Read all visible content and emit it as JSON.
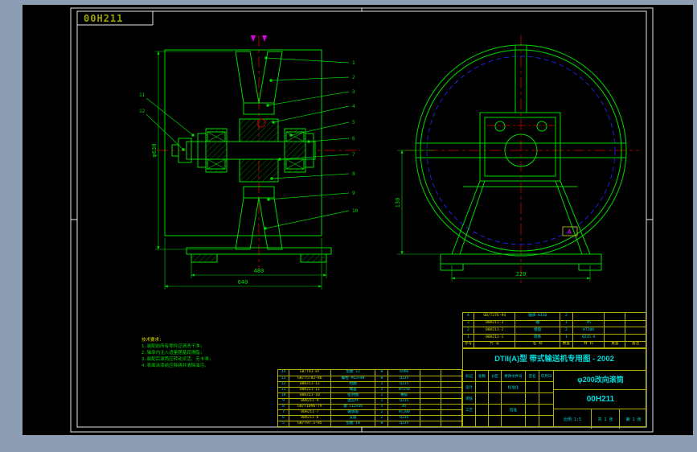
{
  "window": {
    "drawing_label": "00H211"
  },
  "colors": {
    "line_green": "#00d800",
    "center_red": "#d40000",
    "dash_blue": "#2222ee",
    "grid_yellow": "#b0b000",
    "text_cyan": "#00dcdc",
    "magenta": "#e000e0",
    "frame_white": "#e8e8e8",
    "label_olive": "#9aa000",
    "canvas_black": "#000000",
    "window_gray": "#8d9db4"
  },
  "notes": {
    "lines": [
      "技术要求:",
      "1.装配前所有零件应清洗干净;",
      "2.轴承内注入适量锂基润滑脂;",
      "3.装配后滚筒应转动灵活、无卡滞;",
      "4.表面涂漆前应除锈并清除油污。"
    ]
  },
  "left_view": {
    "callouts": [
      "1",
      "2",
      "3",
      "4",
      "5",
      "6",
      "7",
      "8",
      "9",
      "10",
      "11",
      "12"
    ],
    "dim_width_inner": "480",
    "dim_width_outer": "640",
    "dim_left": "φ630"
  },
  "right_view": {
    "dim_bottom": "220",
    "dim_left": "130",
    "detail_label": "A"
  },
  "title_block": {
    "std_line": "DTII(A)型 带式输送机专用图 - 2002",
    "part_name": "φ200改向滚筒",
    "drawing_no": "00H211",
    "scale_text": "比例 1:5",
    "sheet_total": "共 1 张",
    "sheet_no": "第 1 张",
    "sig_rows": [
      [
        "标记",
        "处数",
        "分区",
        "更改文件号",
        "签名",
        "年月日"
      ],
      [
        "设计",
        "",
        "",
        "标准化",
        "",
        ""
      ],
      [
        "审核",
        "",
        "",
        "",
        "",
        ""
      ],
      [
        "工艺",
        "",
        "",
        "批准",
        "",
        ""
      ],
      [
        "",
        "",
        "",
        "",
        "",
        ""
      ]
    ]
  },
  "bom_upper": {
    "rows": [
      [
        "4",
        "GB/T276-94",
        "轴承 6310",
        "2",
        "",
        "",
        ""
      ],
      [
        "3",
        "00H211-3",
        "轴",
        "1",
        "45",
        "",
        ""
      ],
      [
        "2",
        "00H211-2",
        "接盘",
        "2",
        "HT200",
        "",
        ""
      ],
      [
        "1",
        "00H211-1",
        "筒体",
        "1",
        "Q235-A",
        "",
        ""
      ]
    ],
    "headers": [
      "序号",
      "代 号",
      "名 称",
      "数量",
      "材 料",
      "重量",
      "备注"
    ]
  },
  "bom_left": {
    "rows": [
      [
        "14",
        "GB/T93-87",
        "垫圈 12",
        "8",
        "65Mn",
        "",
        ""
      ],
      [
        "13",
        "GB/T5782-86",
        "螺栓 M12×40",
        "8",
        "Q235",
        "",
        ""
      ],
      [
        "12",
        "00H211-12",
        "挡圈",
        "2",
        "Q235",
        "",
        ""
      ],
      [
        "11",
        "00H211-11",
        "端盖",
        "2",
        "HT150",
        "",
        ""
      ],
      [
        "10",
        "00H211-10",
        "密封圈",
        "2",
        "橡胶",
        "",
        ""
      ],
      [
        "9",
        "00H211-9",
        "迷宫环",
        "2",
        "Q235",
        "",
        ""
      ],
      [
        "8",
        "GB/T1096-79",
        "键 C12×56",
        "1",
        "45",
        "",
        ""
      ],
      [
        "7",
        "00H211-7",
        "轴承座",
        "2",
        "HT200",
        "",
        ""
      ],
      [
        "6",
        "00H211-6",
        "支座",
        "2",
        "Q235",
        "",
        ""
      ],
      [
        "5",
        "GB/T97.1-85",
        "垫圈 10",
        "8",
        "Q235",
        "",
        ""
      ]
    ]
  }
}
